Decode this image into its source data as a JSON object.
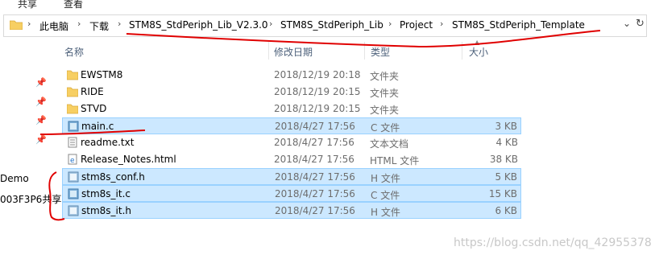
{
  "top_strip": {
    "share_label": "共享",
    "view_label": "查看"
  },
  "address_bar": {
    "crumbs": [
      "此电脑",
      "下载",
      "STM8S_StdPeriph_Lib_V2.3.0",
      "STM8S_StdPeriph_Lib",
      "Project",
      "STM8S_StdPeriph_Template"
    ],
    "dropdown_icon": "chevron-down-icon",
    "refresh_icon": "refresh-icon"
  },
  "columns": {
    "name": "名称",
    "date": "修改日期",
    "type": "类型",
    "size": "大小"
  },
  "files": [
    {
      "name": "EWSTM8",
      "date": "2018/12/19 20:18",
      "type": "文件夹",
      "size": "",
      "icon": "folder-icon",
      "selected": false
    },
    {
      "name": "RIDE",
      "date": "2018/12/19 20:15",
      "type": "文件夹",
      "size": "",
      "icon": "folder-icon",
      "selected": false
    },
    {
      "name": "STVD",
      "date": "2018/12/19 20:15",
      "type": "文件夹",
      "size": "",
      "icon": "folder-icon",
      "selected": false
    },
    {
      "name": "main.c",
      "date": "2018/4/27 17:56",
      "type": "C 文件",
      "size": "3 KB",
      "icon": "c-file-icon",
      "selected": true
    },
    {
      "name": "readme.txt",
      "date": "2018/4/27 17:56",
      "type": "文本文档",
      "size": "4 KB",
      "icon": "text-file-icon",
      "selected": false
    },
    {
      "name": "Release_Notes.html",
      "date": "2018/4/27 17:56",
      "type": "HTML 文件",
      "size": "38 KB",
      "icon": "html-file-icon",
      "selected": false
    },
    {
      "name": "stm8s_conf.h",
      "date": "2018/4/27 17:56",
      "type": "H 文件",
      "size": "5 KB",
      "icon": "h-file-icon",
      "selected": true
    },
    {
      "name": "stm8s_it.c",
      "date": "2018/4/27 17:56",
      "type": "C 文件",
      "size": "15 KB",
      "icon": "c-file-icon",
      "selected": true
    },
    {
      "name": "stm8s_it.h",
      "date": "2018/4/27 17:56",
      "type": "H 文件",
      "size": "6 KB",
      "icon": "h-file-icon",
      "selected": true
    }
  ],
  "left_pane": {
    "label1": "Demo",
    "label2": "003F3P6共享"
  },
  "watermark": "https://blog.csdn.net/qq_42955378",
  "colors": {
    "selection": "#cce8ff",
    "selection_border": "#99d1ff",
    "folder": "#f7cf63",
    "annotation": "#e00000"
  }
}
